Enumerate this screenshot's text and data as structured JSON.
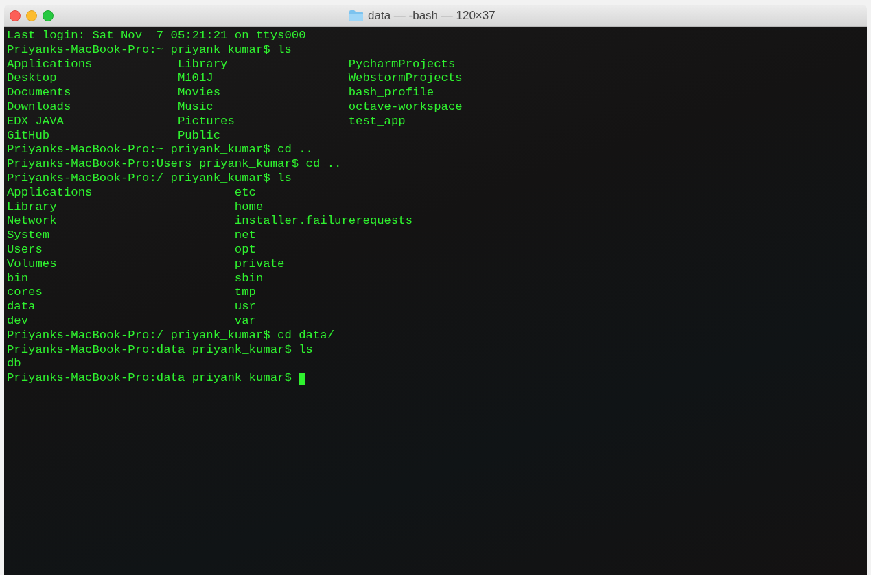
{
  "window": {
    "title": "data — -bash — 120×37"
  },
  "terminal": {
    "lines": [
      {
        "kind": "text",
        "text": "Last login: Sat Nov  7 05:21:21 on ttys000"
      },
      {
        "kind": "text",
        "text": "Priyanks-MacBook-Pro:~ priyank_kumar$ ls"
      },
      {
        "kind": "columns",
        "columns": [
          [
            "Applications",
            "Desktop",
            "Documents",
            "Downloads",
            "EDX JAVA",
            "GitHub"
          ],
          [
            "Library",
            "M101J",
            "Movies",
            "Music",
            "Pictures",
            "Public"
          ],
          [
            "PycharmProjects",
            "WebstormProjects",
            "bash_profile",
            "octave-workspace",
            "test_app"
          ]
        ]
      },
      {
        "kind": "text",
        "text": "Priyanks-MacBook-Pro:~ priyank_kumar$ cd .."
      },
      {
        "kind": "text",
        "text": "Priyanks-MacBook-Pro:Users priyank_kumar$ cd .."
      },
      {
        "kind": "text",
        "text": "Priyanks-MacBook-Pro:/ priyank_kumar$ ls"
      },
      {
        "kind": "columns",
        "columns": [
          [
            "Applications",
            "Library",
            "Network",
            "System",
            "Users",
            "Volumes",
            "bin",
            "cores",
            "data",
            "dev"
          ],
          [
            "etc",
            "home",
            "installer.failurerequests",
            "net",
            "opt",
            "private",
            "sbin",
            "tmp",
            "usr",
            "var"
          ]
        ]
      },
      {
        "kind": "text",
        "text": "Priyanks-MacBook-Pro:/ priyank_kumar$ cd data/"
      },
      {
        "kind": "text",
        "text": "Priyanks-MacBook-Pro:data priyank_kumar$ ls"
      },
      {
        "kind": "text",
        "text": "db"
      },
      {
        "kind": "prompt",
        "text": "Priyanks-MacBook-Pro:data priyank_kumar$",
        "cursor": true
      }
    ]
  }
}
